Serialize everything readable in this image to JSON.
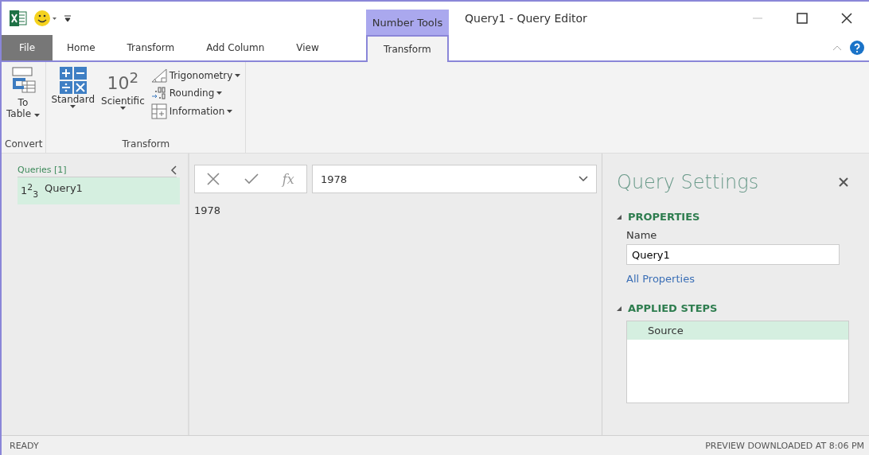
{
  "window": {
    "title": "Query1 - Query Editor",
    "context_tab_group": "Number Tools"
  },
  "tabs": [
    {
      "label": "File",
      "kind": "file",
      "selected": false
    },
    {
      "label": "Home",
      "kind": "tab",
      "selected": false
    },
    {
      "label": "Transform",
      "kind": "tab",
      "selected": false
    },
    {
      "label": "Add Column",
      "kind": "tab",
      "selected": false
    },
    {
      "label": "View",
      "kind": "tab",
      "selected": false
    },
    {
      "label": "Transform",
      "kind": "context",
      "selected": true
    }
  ],
  "ribbon": {
    "groups": [
      {
        "label": "Convert",
        "items": [
          {
            "kind": "large",
            "lines": [
              "To",
              "Table"
            ]
          }
        ]
      },
      {
        "label": "Transform",
        "items": [
          {
            "kind": "large",
            "lines": [
              "Standard"
            ]
          },
          {
            "kind": "large",
            "icon_text": "10$^{2}$",
            "lines": [
              "Scientific"
            ]
          },
          {
            "kind": "stack",
            "entries": [
              {
                "label": "Trigonometry"
              },
              {
                "label": "Rounding"
              },
              {
                "label": "Information"
              }
            ]
          }
        ]
      }
    ]
  },
  "queries": {
    "header": "Queries [1]",
    "items": [
      {
        "type_icon": "1$^{2}$$_{3}$",
        "name": "Query1",
        "selected": true
      }
    ]
  },
  "formula_bar": {
    "fx": "fx",
    "value": "1978"
  },
  "preview": {
    "value": "1978"
  },
  "settings": {
    "title": "Query Settings",
    "properties_header": "PROPERTIES",
    "name_label": "Name",
    "name_value": "Query1",
    "all_properties": "All Properties",
    "steps_header": "APPLIED STEPS",
    "steps": [
      {
        "name": "Source",
        "selected": true
      }
    ]
  },
  "status_bar": {
    "left": "READY",
    "right": "PREVIEW DOWNLOADED AT 8:06 PM"
  }
}
